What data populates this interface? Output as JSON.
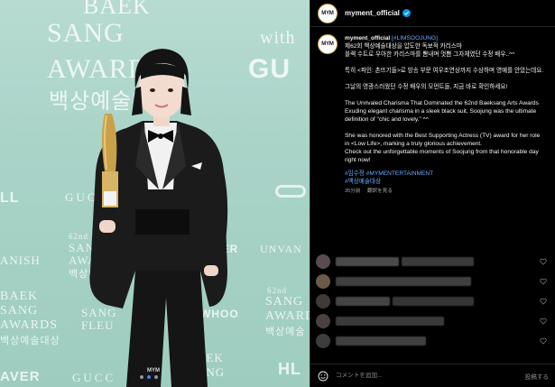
{
  "photo": {
    "backdrop_words": {
      "baek": "BAEK",
      "sang": "SANG",
      "awards": "AWARDS",
      "with": "with",
      "gu": "GU",
      "korean_title": "백상예술대상",
      "ll": "LL",
      "gucci": "GUCCI",
      "anish": "ANISH",
      "year_62": "62nd",
      "sang_small": "SANG",
      "awards_small": "AWARDS",
      "ko_small": "백상예술",
      "ber": "BER",
      "unvan": "UNVAN",
      "baek2": "BAEK",
      "sang2": "SANG",
      "awards2": "AWARDS",
      "ko2": "백상예술대상",
      "sang3": "SANG",
      "fleu": "FLEU",
      "whoo": "WHOO",
      "year_62b": "62nd",
      "sang4": "SANG",
      "award4": "AWARD",
      "ko3": "백상예술",
      "aek": "AEK",
      "ang": "ANG",
      "hl": "HL",
      "aver": "AVER",
      "gucci2": "GUCC"
    },
    "watermark": "MYM",
    "carousel_active_index": 1,
    "carousel_count": 3
  },
  "header": {
    "avatar_text": "MYM",
    "username": "myment_official"
  },
  "caption": {
    "username": "myment_official",
    "hashtag_open": "[#LIMSOOJUNG]",
    "ko_line1": "제62회 백상예술대상을 압도한 독보적 카리스마",
    "ko_line2": "블랙 수트로 우아한 카리스마를 뽐내며 멋쁨 그자체였던 수정 배우..^^",
    "ko_para2": "특히 <파인: 촌뜨기들>로 방송 부문 여우조연상까지 수상하며 영예를 안았는데요.",
    "ko_para3": "그날의 영광스러웠던 수정 배우의 모먼트들, 지금 바로 확인하세요!",
    "en_para1": "The Unrivaled Charisma That Dominated the 62nd Baeksang Arts Awards\nExuding elegant charisma in a sleek black suit, Soojung was the ultimate definition of \"chic and lovely.\" ^^",
    "en_para2": "She was honored with the Best Supporting Actress (TV) award for her role in <Low Life>, marking a truly glorious achievement.\nCheck out the unforgettable moments of Soojung from that honorable day right now!",
    "tags_line1": "#임수정 #MYMENTERTAINMENT",
    "tags_line2": "#백상예술대상",
    "time_ago": "35分前",
    "translate": "翻訳を見る"
  },
  "comment_box": {
    "placeholder": "コメントを追加...",
    "post_label": "投稿する"
  },
  "colors": {
    "accent": "#3b82f6",
    "link": "#6ea8ff",
    "bg": "#000000",
    "backdrop": "#a9d3c8"
  },
  "icons": [
    "verified-badge-icon",
    "smile-icon",
    "heart-icon"
  ]
}
